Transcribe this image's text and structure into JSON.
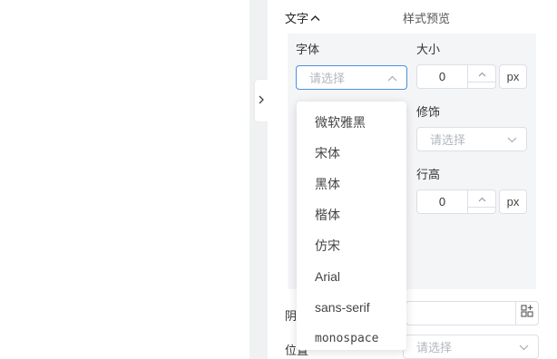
{
  "section": {
    "title": "文字",
    "preview_title": "样式预览"
  },
  "font": {
    "label": "字体",
    "placeholder": "请选择",
    "options": [
      "微软雅黑",
      "宋体",
      "黑体",
      "楷体",
      "仿宋",
      "Arial",
      "sans-serif",
      "monospace"
    ]
  },
  "size": {
    "label": "大小",
    "value": "0",
    "unit": "px"
  },
  "decoration": {
    "label": "修饰",
    "placeholder": "请选择"
  },
  "line_height": {
    "label": "行高",
    "value": "0",
    "unit": "px"
  },
  "shadow": {
    "label": "阴"
  },
  "position": {
    "label": "位置",
    "placeholder": "请选择"
  },
  "colors": {
    "accent": "#4a90e2",
    "panel_bg": "#f4f5f7",
    "border": "#dcdfe6"
  }
}
